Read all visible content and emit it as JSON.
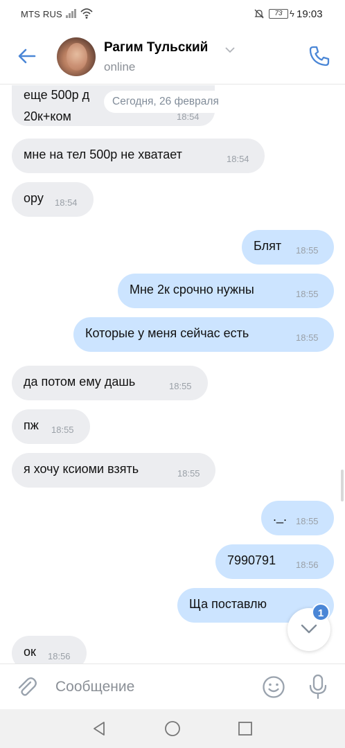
{
  "status_bar": {
    "carrier": "MTS RUS",
    "battery": "73",
    "time": "19:03"
  },
  "header": {
    "contact_name": "Рагим Тульский",
    "contact_status": "online"
  },
  "date_divider": "Сегодня, 26 февраля",
  "messages": [
    {
      "dir": "in",
      "text": "еще 500р д\n20к+ком",
      "time": "18:54"
    },
    {
      "dir": "in",
      "text": "мне на тел 500р не хватает",
      "time": "18:54"
    },
    {
      "dir": "in",
      "text": "ору",
      "time": "18:54"
    },
    {
      "dir": "out",
      "text": "Блят",
      "time": "18:55"
    },
    {
      "dir": "out",
      "text": "Мне 2к срочно нужны",
      "time": "18:55"
    },
    {
      "dir": "out",
      "text": "Которые у меня сейчас есть",
      "time": "18:55"
    },
    {
      "dir": "in",
      "text": "да потом ему дашь",
      "time": "18:55"
    },
    {
      "dir": "in",
      "text": "пж",
      "time": "18:55"
    },
    {
      "dir": "in",
      "text": "я хочу ксиоми взять",
      "time": "18:55"
    },
    {
      "dir": "out",
      "text": "._.",
      "time": "18:55"
    },
    {
      "dir": "out",
      "text": "7990791",
      "time": "18:56"
    },
    {
      "dir": "out",
      "text": "Ща поставлю",
      "time": ""
    },
    {
      "dir": "in",
      "text": "ок",
      "time": "18:56"
    }
  ],
  "scroll_down": {
    "unread_count": "1"
  },
  "composer": {
    "placeholder": "Сообщение"
  },
  "colors": {
    "accent": "#4a86d6",
    "incoming_bubble": "#ecedf0",
    "outgoing_bubble": "#cce4ff",
    "time_text": "#9aa0a7"
  },
  "icons": {
    "back": "arrow-left-icon",
    "call": "phone-icon",
    "attach": "paperclip-icon",
    "emoji": "smiley-icon",
    "mic": "microphone-icon",
    "scroll_down": "chevron-down-icon"
  }
}
